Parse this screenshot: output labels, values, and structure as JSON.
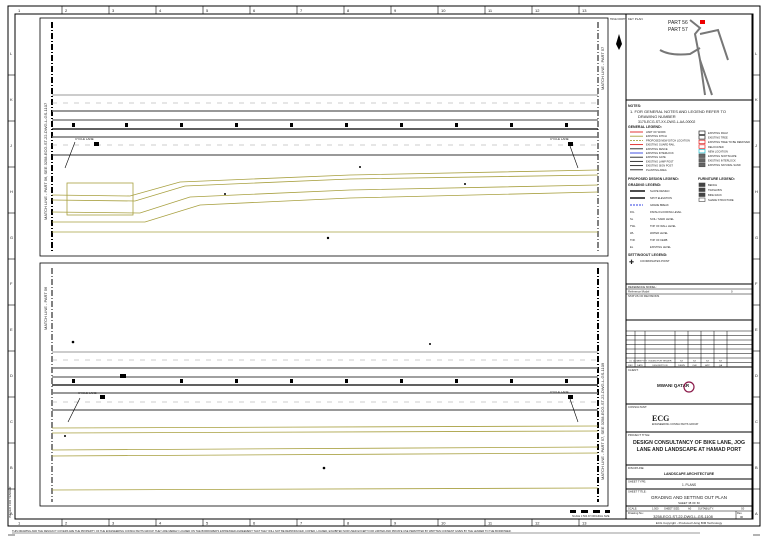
{
  "grid": {
    "columns": [
      "1",
      "2",
      "3",
      "4",
      "5",
      "6",
      "7",
      "8",
      "9",
      "10",
      "11",
      "12",
      "13"
    ],
    "rows": [
      "L",
      "K",
      "J",
      "H",
      "G",
      "F",
      "E",
      "D",
      "C",
      "B",
      "A"
    ]
  },
  "plan": {
    "top_matchline_left": "MATCH LINE - PART 56, SEE 3258-ECG-ST-22-DWG-L-GS-1107",
    "top_matchline_right": "MATCH LINE - PART 57",
    "bottom_matchline_left": "MATCH LINE - PART 56",
    "bottom_matchline_right": "MATCH LINE - PART 57, SEE 3258-ECG-ST-22-DWG-L-GS-1109",
    "callout_1": "CYCLE LANE",
    "callout_2": "CYCLE LANE",
    "callout_3": "CYCLE LANE",
    "callout_4": "CYCLE LANE"
  },
  "key_plan": {
    "title": "KEY PLAN",
    "part_a": "PART 56",
    "part_b": "PART 57",
    "north": "TRUE NORTH"
  },
  "notes": {
    "title": "NOTES:",
    "note_1a": "1.  FOR GENERAL NOTES AND LEGEND REFER TO",
    "note_1b": "DRAWING NUMBER",
    "note_1c": "3175-ECG-ST-XX-DWG-L-AA-00002"
  },
  "general_legend": {
    "title": "GENERAL LEGEND:",
    "left": [
      {
        "label": "LIMIT OF WORK",
        "color": "#e02020"
      },
      {
        "label": "EXISTING DITCH",
        "color": "#a8a040"
      },
      {
        "label": "PROPOSED NEW DITCH LOCATION",
        "color": "#a8a040"
      },
      {
        "label": "EXISTING GUARD RAIL",
        "color": "#e02020"
      },
      {
        "label": "EXISTING FENCE",
        "color": "#222222"
      },
      {
        "label": "EXISTING INTERLOCK",
        "color": "#3040e0"
      },
      {
        "label": "EXISTING GATE",
        "color": "#222222"
      },
      {
        "label": "EXISTING LAMP POST",
        "color": "#222222"
      },
      {
        "label": "EXISTING SIGN POST",
        "color": "#222222"
      },
      {
        "label": "PLANTING AREA",
        "color": "#222222"
      }
    ],
    "right": [
      {
        "label": "EXISTING PALM"
      },
      {
        "label": "EXISTING TREE"
      },
      {
        "label": "EXISTING TREE TO BE REMOVED"
      },
      {
        "label": "RELOCATED"
      },
      {
        "label": "NEW LOCATION"
      },
      {
        "label": "EXISTING SOFTSCAPE"
      },
      {
        "label": "EXISTING INTERLOCK"
      },
      {
        "label": "EXISTING NATURAL SAND"
      }
    ]
  },
  "proposed_legend": {
    "title": "PROPOSED DESIGN LEGEND:",
    "grading_title": "GRADING LEGEND:",
    "items": [
      {
        "sym": "",
        "label": "SLOPE DESIGN"
      },
      {
        "sym": "",
        "label": "SPOT ELEVATION"
      },
      {
        "sym": "",
        "label": "GRADE BREAK"
      },
      {
        "sym": "FFL",
        "label": "FINISH FLOORING LEVEL"
      },
      {
        "sym": "SL",
        "label": "SOIL / SAND LEVEL"
      },
      {
        "sym": "TWL",
        "label": "TOP OF WALL LEVEL"
      },
      {
        "sym": "WL",
        "label": "WATER LEVEL"
      },
      {
        "sym": "TOK",
        "label": "TOP OF KERB"
      },
      {
        "sym": "EL",
        "label": "EXISTING LEVEL"
      }
    ],
    "setting_title": "SETTINGOUT LEGEND:",
    "setting_item": "COORDINATES POINT"
  },
  "furniture_legend": {
    "title": "FURNITURE LEGEND:",
    "items": [
      "BENCH",
      "TRASH BIN",
      "BIKE RACK",
      "SHADE STRUCTURE"
    ]
  },
  "title_block": {
    "reference_model_label": "REFERENCE MODEL:",
    "reference_model_value": "Reference Model",
    "reference_model_num": "0",
    "stamp_label": "STATUS OF REVISIONS",
    "rev_rows": [
      [
        "01",
        "DD/MM/YYYY",
        "ISSUED FOR TENDER",
        "XX",
        "XX",
        "XX",
        "XX"
      ],
      [
        "REV",
        "DATE",
        "DESCRIPTION",
        "DRWN",
        "CHK",
        "APP",
        "QA"
      ]
    ],
    "client_label": "CLIENT:",
    "client_name": "MWANI QATAR",
    "consultant_label": "CONSULTANT:",
    "consultant_name": "ECG",
    "consultant_sub": "ENGINEERING CONSULTANTS GROUP",
    "project_label": "PROJECT TITLE:",
    "project_title_1": "DESIGN CONSULTANCY OF BIKE LANE, JOG",
    "project_title_2": "LANE AND LANDSCAPE AT HAMAD PORT",
    "discipline_label": "DISCIPLINE:",
    "discipline": "LANDSCAPE ARCHITECTURE",
    "sheet_type_label": "SHEET TYPE:",
    "sheet_type": "1. PLANS",
    "sheet_title_label": "SHEET TITLE:",
    "sheet_title": "GRADING AND SETTING OUT PLAN",
    "sheet_of": "SHEET 38 OF 60",
    "scale_label": "SCALE:",
    "scale": "1:500",
    "sheet_size_label": "SHEET SIZE:",
    "sheet_size": "A0",
    "suitability_label": "SUITABILITY:",
    "suitability": "S0",
    "drawing_no_label": "Drawing No.:",
    "drawing_no": "3258-ECG-ST-22-DWG-L-GS-1108",
    "rev_label": "Rev.",
    "rev": "00",
    "copyright": "ECG Copyright - Produced Using BIM Technology"
  },
  "scale_bar": {
    "label": "SCALE 1:500 AT ORIGINAL SIZE"
  },
  "footer": {
    "disclaimer": "THIS DRAWING AND THE DESIGN IT COVERS ARE THE PROPERTY OF THE ENGINEERING CONSULTANTS GROUP. THEY ARE MERELY LOANED ON THE BORROWER'S EXPRESSED AGREEMENT THAT THEY WILL NOT BE REPRODUCED, COPIED, LOANED, EXHIBITED NOR USED EXCEPT FOR LIMITED AND PRIVATE USE PERMITTED BY WRITTEN CONSENT GIVEN BY THE LENDER TO THE BORROWER.",
    "side_note": "ISSUED FOR TENDER"
  }
}
